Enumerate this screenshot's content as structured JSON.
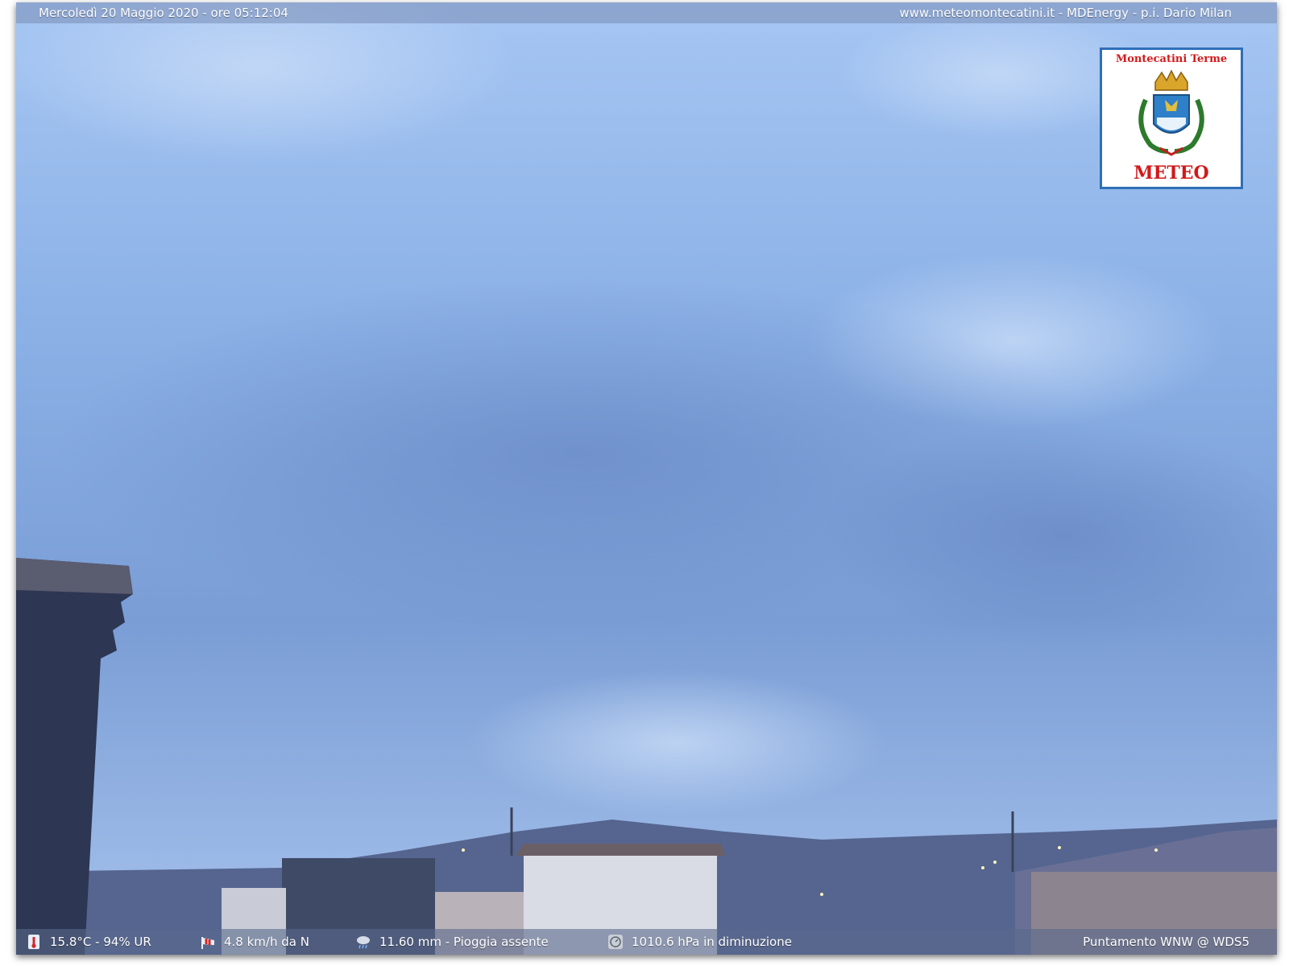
{
  "header": {
    "date_time": "Mercoledì 20 Maggio 2020 - ore 05:12:04",
    "credits": "www.meteomontecatini.it - MDEnergy - p.i. Dario Milan"
  },
  "logo": {
    "title": "Montecatini Terme",
    "caption": "METEO"
  },
  "stats": [
    {
      "icon": "thermometer-icon",
      "text": "15.8°C - 94% UR"
    },
    {
      "icon": "windsock-icon",
      "text": "4.8 km/h da N"
    },
    {
      "icon": "rain-cloud-icon",
      "text": "11.60 mm - Pioggia assente"
    },
    {
      "icon": "barometer-icon",
      "text": "1010.6 hPa in diminuzione"
    }
  ],
  "pointing": "Puntamento WNW  @ WDS5",
  "colors": {
    "sky_top": "#9ec2f2",
    "sky_mid": "#7b9fd6",
    "hills": "#5d6f9c",
    "logo_red": "#d11a1a",
    "logo_border": "#2f6fb8"
  }
}
